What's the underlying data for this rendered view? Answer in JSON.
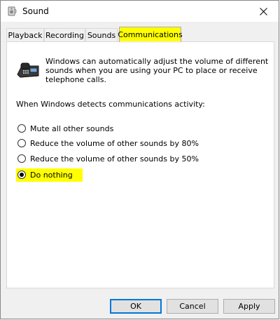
{
  "window": {
    "title": "Sound"
  },
  "tabs": [
    {
      "label": "Playback",
      "active": false
    },
    {
      "label": "Recording",
      "active": false
    },
    {
      "label": "Sounds",
      "active": false
    },
    {
      "label": "Communications",
      "active": true
    }
  ],
  "panel": {
    "description": "Windows can automatically adjust the volume of different sounds when you are using your PC to place or receive telephone calls.",
    "prompt": "When Windows detects communications activity:",
    "options": [
      {
        "label": "Mute all other sounds",
        "checked": false
      },
      {
        "label": "Reduce the volume of other sounds by 80%",
        "checked": false
      },
      {
        "label": "Reduce the volume of other sounds by 50%",
        "checked": false
      },
      {
        "label": "Do nothing",
        "checked": true
      }
    ]
  },
  "buttons": {
    "ok": "OK",
    "cancel": "Cancel",
    "apply": "Apply"
  },
  "colors": {
    "highlight": "#ffff00",
    "accent": "#0078d7"
  },
  "icons": {
    "title": "speaker-icon",
    "close": "close-icon",
    "panel": "telephone-icon"
  }
}
